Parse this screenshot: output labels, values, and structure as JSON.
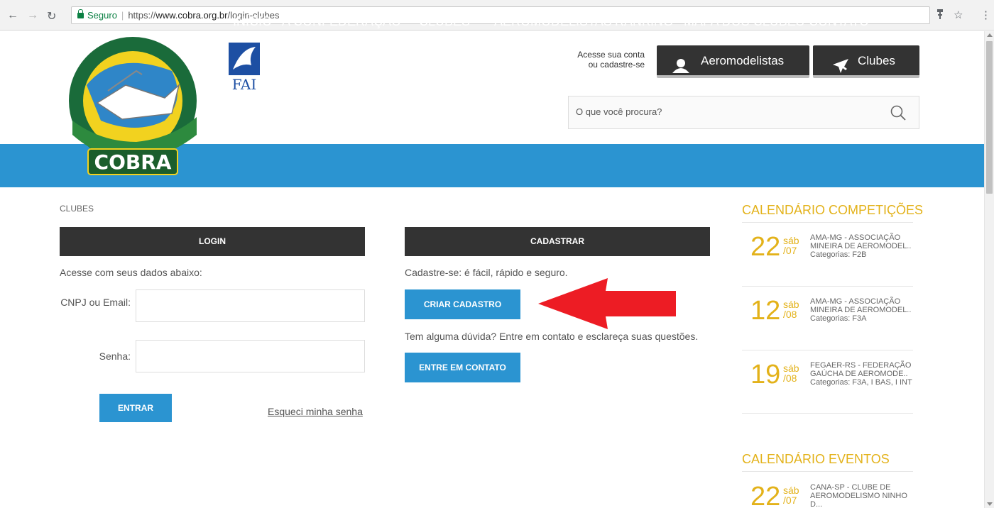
{
  "browser": {
    "secure_label": "Seguro",
    "url_prefix": "https://",
    "url_domain": "www.cobra.org.br",
    "url_path": "/login-clubes"
  },
  "header": {
    "logo_alt": "COBRA",
    "fai_label": "FAI",
    "acesse_line1": "Acesse sua conta",
    "acesse_line2": "ou cadastre-se",
    "aeromodelistas_btn": "Aeromodelistas",
    "clubes_btn": "Clubes",
    "search_placeholder": "O que você procura?"
  },
  "nav": {
    "items": [
      "INÍCIO",
      "A CONFEDERAÇÃO",
      "CLUBES",
      "AEROMODELISTAS",
      "RANKING",
      "MAPA DOS CLUBES",
      "CONTATO"
    ]
  },
  "breadcrumb": "CLUBES",
  "login": {
    "heading": "LOGIN",
    "intro": "Acesse com seus dados abaixo:",
    "cnpj_label": "CNPJ ou Email:",
    "senha_label": "Senha:",
    "submit": "ENTRAR",
    "forgot": "Esqueci minha senha"
  },
  "cadastrar": {
    "heading": "CADASTRAR",
    "intro": "Cadastre-se: é fácil, rápido e seguro.",
    "create_btn": "CRIAR CADASTRO",
    "doubt": "Tem alguma dúvida? Entre em contato e esclareça suas questões.",
    "contact_btn": "ENTRE EM CONTATO"
  },
  "sidebar": {
    "competicoes_title": "CALENDÁRIO COMPETIÇÕES",
    "competicoes": [
      {
        "day": "22",
        "dow": "sáb",
        "mon": "/07",
        "title": "AMA-MG - ASSOCIAÇÃO MINEIRA DE AEROMODEL..",
        "cats": "Categorias: F2B"
      },
      {
        "day": "12",
        "dow": "sáb",
        "mon": "/08",
        "title": "AMA-MG - ASSOCIAÇÃO MINEIRA DE AEROMODEL..",
        "cats": "Categorias: F3A"
      },
      {
        "day": "19",
        "dow": "sáb",
        "mon": "/08",
        "title": "FEGAER-RS - FEDERAÇÃO GAÚCHA DE AEROMODE..",
        "cats": "Categorias: F3A, I BAS, I INT"
      }
    ],
    "eventos_title": "CALENDÁRIO EVENTOS",
    "eventos": [
      {
        "day": "22",
        "dow": "sáb",
        "mon": "/07",
        "title": "CANA-SP - CLUBE DE AEROMODELISMO NINHO D..."
      }
    ]
  },
  "colors": {
    "nav_blue": "#2b94d1",
    "dark": "#333333",
    "gold": "#e3b21a",
    "arrow_red": "#ed1c24"
  }
}
